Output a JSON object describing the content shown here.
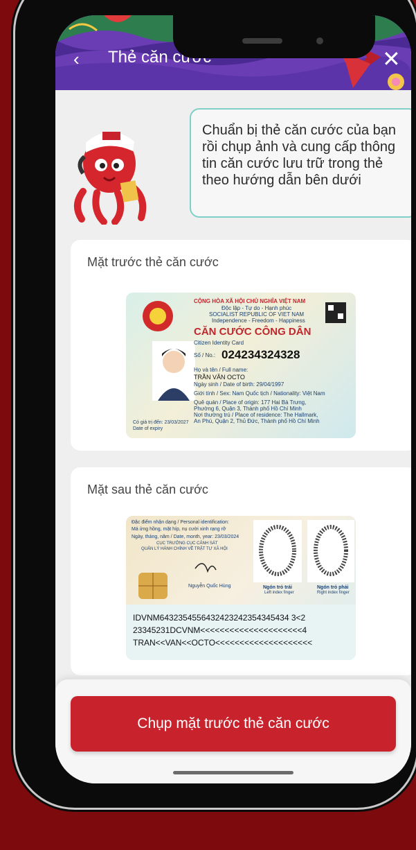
{
  "header": {
    "title": "Thẻ căn cước"
  },
  "intro": {
    "text": "Chuẩn bị thẻ căn cước của bạn rồi chụp ảnh và cung cấp thông tin căn cước lưu trữ trong thẻ theo hướng dẫn bên dưới"
  },
  "front_card": {
    "label": "Mặt trước thẻ căn cước",
    "id": {
      "country": "CỘNG HÒA XÃ HỘI CHỦ NGHĨA VIỆT NAM",
      "motto": "Độc lập - Tự do - Hạnh phúc",
      "country_en": "SOCIALIST REPUBLIC OF VIET NAM",
      "motto_en": "Independence - Freedom - Happiness",
      "title": "CĂN CƯỚC CÔNG DÂN",
      "subtitle": "Citizen Identity Card",
      "number_label": "Số / No.:",
      "number": "024234324328",
      "name_label": "Họ và tên / Full name:",
      "name": "TRẦN VĂN OCTO",
      "dob": "Ngày sinh / Date of birth:  29/04/1997",
      "sex_nat": "Giới tính / Sex: Nam     Quốc tịch / Nationality: Việt Nam",
      "origin": "Quê quán / Place of origin: 177 Hai Bà Trưng,",
      "origin2": "Phường 6, Quận 3, Thành phố Hồ Chí Minh",
      "residence": "Nơi thường trú / Place of residence: The Hallmark,",
      "residence2": "An Phú, Quận 2, Thủ Đức, Thành phố Hồ Chí Minh",
      "expiry": "Có giá trị đến: 23/03/2027",
      "expiry_en": "Date of expiry"
    }
  },
  "back_card": {
    "label": "Mặt sau thẻ căn cước",
    "id": {
      "ident_label": "Đặc điểm nhận dạng / Personal identification:",
      "ident": "Má ửng hồng, mặt híp, nụ cười xinh rạng rỡ",
      "date": "Ngày, tháng, năm / Date, month, year: 23/03/2024",
      "office1": "CỤC TRƯỞNG CỤC CẢNH SÁT",
      "office2": "QUẢN LÝ HÀNH CHÍNH VỀ TRẬT TỰ XÃ HỘI",
      "signer": "Nguyễn Quốc Hùng",
      "left_finger": "Ngón trỏ trái",
      "left_finger_en": "Left index finger",
      "right_finger": "Ngón trỏ phải",
      "right_finger_en": "Right index finger",
      "mrz1": "IDVNM6432354556432423242354345434 3<2",
      "mrz2": "23345231DCVNM<<<<<<<<<<<<<<<<<<<<<4",
      "mrz3": "TRAN<<VAN<<OCTO<<<<<<<<<<<<<<<<<<<<"
    }
  },
  "cta": {
    "label": "Chụp mặt trước thẻ căn cước"
  },
  "colors": {
    "background": "#7d0a0c",
    "primary": "#c8232c",
    "bubble_border": "#7fd0c9"
  }
}
